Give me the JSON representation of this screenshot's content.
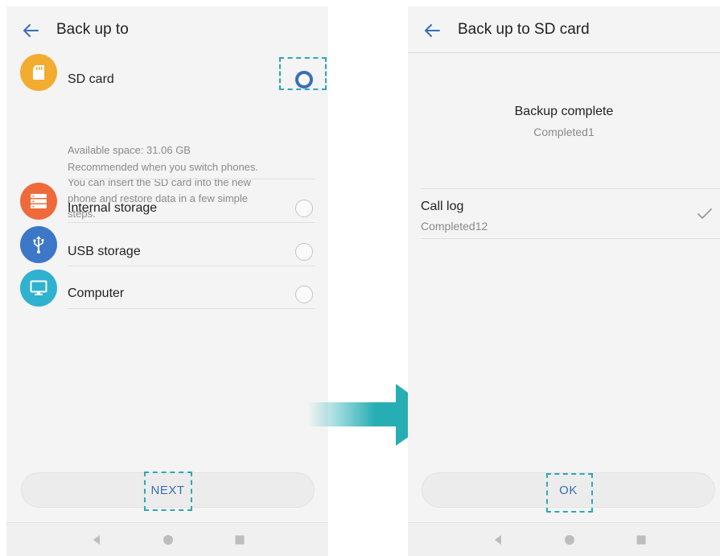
{
  "left_screen": {
    "title": "Back up to",
    "options": [
      {
        "label": "SD card",
        "icon": "sd-card-icon",
        "color": "#f2ac2f",
        "selected": true
      },
      {
        "label": "Internal storage",
        "icon": "storage-icon",
        "color": "#ef6a3a",
        "selected": false
      },
      {
        "label": "USB storage",
        "icon": "usb-icon",
        "color": "#3c78c7",
        "selected": false
      },
      {
        "label": "Computer",
        "icon": "monitor-icon",
        "color": "#2fb2cf",
        "selected": false
      }
    ],
    "sd_details": {
      "available": "Available space: 31.06 GB",
      "lines": [
        "Recommended when you switch phones.",
        "You can insert the SD card into the new",
        "phone and restore data in a few simple",
        "steps."
      ]
    },
    "next_label": "NEXT"
  },
  "right_screen": {
    "title": "Back up to SD card",
    "status_title": "Backup complete",
    "status_sub": "Completed1",
    "item_title": "Call log",
    "item_sub": "Completed12",
    "ok_label": "OK"
  },
  "colors": {
    "accent": "#3a6fb5",
    "highlight": "#2aa9b5",
    "arrow": "#27aeb5"
  },
  "nav_icons": [
    "back-triangle-icon",
    "home-circle-icon",
    "recents-square-icon"
  ]
}
